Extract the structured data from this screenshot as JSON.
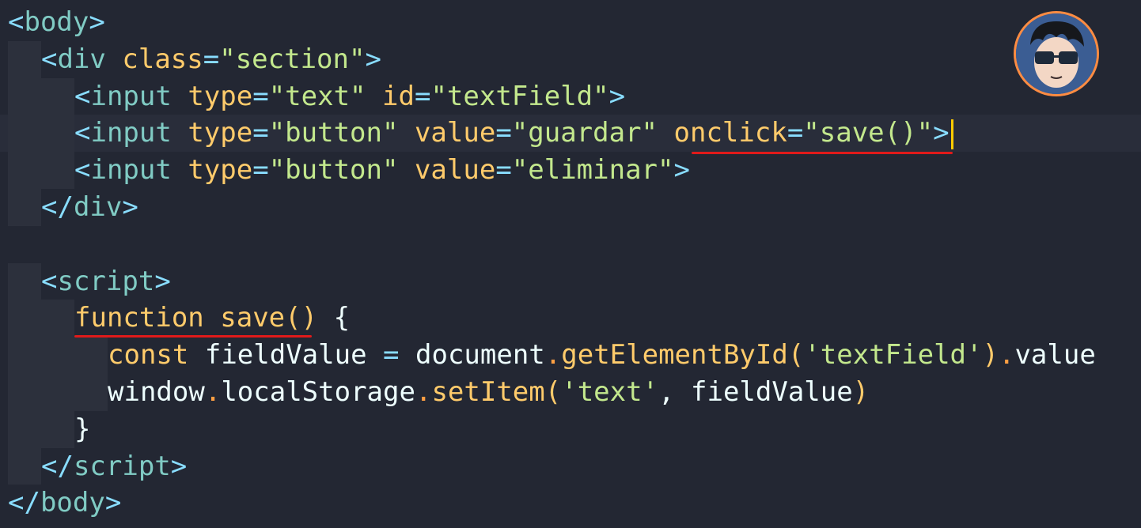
{
  "editor": {
    "lines": [
      {
        "indent": 0,
        "tokens": [
          [
            "punct",
            "<"
          ],
          [
            "tag",
            "body"
          ],
          [
            "punct",
            ">"
          ]
        ]
      },
      {
        "indent": 1,
        "tokens": [
          [
            "punct",
            "<"
          ],
          [
            "tag",
            "div"
          ],
          [
            "plain",
            " "
          ],
          [
            "attr",
            "class"
          ],
          [
            "eq",
            "="
          ],
          [
            "str",
            "\"section\""
          ],
          [
            "punct",
            ">"
          ]
        ]
      },
      {
        "indent": 2,
        "tokens": [
          [
            "punct",
            "<"
          ],
          [
            "tag",
            "input"
          ],
          [
            "plain",
            " "
          ],
          [
            "attr",
            "type"
          ],
          [
            "eq",
            "="
          ],
          [
            "str",
            "\"text\""
          ],
          [
            "plain",
            " "
          ],
          [
            "attr",
            "id"
          ],
          [
            "eq",
            "="
          ],
          [
            "str",
            "\"textField\""
          ],
          [
            "punct",
            ">"
          ]
        ]
      },
      {
        "indent": 2,
        "active": true,
        "caret": true,
        "tokens": [
          [
            "punct",
            "<"
          ],
          [
            "tag",
            "input"
          ],
          [
            "plain",
            " "
          ],
          [
            "attr",
            "type"
          ],
          [
            "eq",
            "="
          ],
          [
            "str",
            "\"button\""
          ],
          [
            "plain",
            " "
          ],
          [
            "attr",
            "value"
          ],
          [
            "eq",
            "="
          ],
          [
            "str",
            "\"guardar\""
          ],
          [
            "plain",
            " "
          ],
          [
            "attr",
            "onclick"
          ],
          [
            "eq",
            "="
          ],
          [
            "str",
            "\"save()\""
          ],
          [
            "punct",
            ">"
          ]
        ]
      },
      {
        "indent": 2,
        "tokens": [
          [
            "punct",
            "<"
          ],
          [
            "tag",
            "input"
          ],
          [
            "plain",
            " "
          ],
          [
            "attr",
            "type"
          ],
          [
            "eq",
            "="
          ],
          [
            "str",
            "\"button\""
          ],
          [
            "plain",
            " "
          ],
          [
            "attr",
            "value"
          ],
          [
            "eq",
            "="
          ],
          [
            "str",
            "\"eliminar\""
          ],
          [
            "punct",
            ">"
          ]
        ]
      },
      {
        "indent": 1,
        "tokens": [
          [
            "punct",
            "</"
          ],
          [
            "tag",
            "div"
          ],
          [
            "punct",
            ">"
          ]
        ]
      },
      {
        "indent": 0,
        "tokens": []
      },
      {
        "indent": 1,
        "tokens": [
          [
            "punct",
            "<"
          ],
          [
            "tag",
            "script"
          ],
          [
            "punct",
            ">"
          ]
        ]
      },
      {
        "indent": 2,
        "tokens": [
          [
            "kw",
            "function"
          ],
          [
            "plain",
            " "
          ],
          [
            "fn",
            "save"
          ],
          [
            "paren",
            "()"
          ],
          [
            "plain",
            " "
          ],
          [
            "brace",
            "{"
          ]
        ]
      },
      {
        "indent": 3,
        "tokens": [
          [
            "kw",
            "const"
          ],
          [
            "plain",
            " "
          ],
          [
            "id",
            "fieldValue"
          ],
          [
            "plain",
            " "
          ],
          [
            "eq",
            "="
          ],
          [
            "plain",
            " "
          ],
          [
            "id",
            "document"
          ],
          [
            "dot",
            "."
          ],
          [
            "method",
            "getElementById"
          ],
          [
            "paren",
            "("
          ],
          [
            "str",
            "'textField'"
          ],
          [
            "paren",
            ")"
          ],
          [
            "dot",
            "."
          ],
          [
            "id",
            "value"
          ]
        ]
      },
      {
        "indent": 3,
        "tokens": [
          [
            "id",
            "window"
          ],
          [
            "dot",
            "."
          ],
          [
            "id",
            "localStorage"
          ],
          [
            "dot",
            "."
          ],
          [
            "method",
            "setItem"
          ],
          [
            "paren",
            "("
          ],
          [
            "str",
            "'text'"
          ],
          [
            "plain",
            ", "
          ],
          [
            "id",
            "fieldValue"
          ],
          [
            "paren",
            ")"
          ]
        ]
      },
      {
        "indent": 2,
        "tokens": [
          [
            "brace",
            "}"
          ]
        ]
      },
      {
        "indent": 1,
        "tokens": [
          [
            "punct",
            "</"
          ],
          [
            "tag",
            "script"
          ],
          [
            "punct",
            ">"
          ]
        ]
      },
      {
        "indent": 0,
        "tokens": [
          [
            "punct",
            "</"
          ],
          [
            "tag",
            "body"
          ],
          [
            "punct",
            ">"
          ]
        ]
      }
    ]
  },
  "annotations": {
    "underline_color": "#e01a1a",
    "underlined": [
      "onclick=\"save()\"",
      "function save()"
    ]
  },
  "avatar": {
    "icon": "cartoon-avatar-with-sunglasses-icon",
    "border_color": "#ff8c42"
  },
  "colors": {
    "background": "#232733",
    "active_line": "#292d3a",
    "caret": "#ffcc00"
  }
}
